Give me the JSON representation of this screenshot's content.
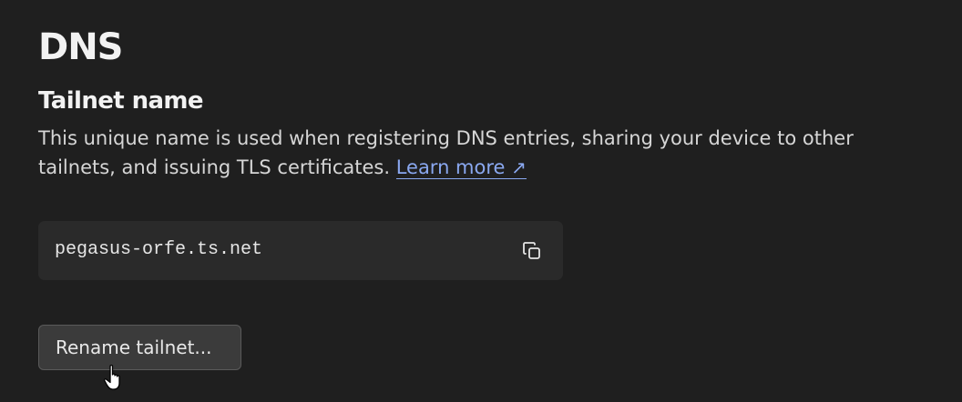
{
  "page": {
    "title": "DNS"
  },
  "tailnet_name": {
    "heading": "Tailnet name",
    "description": "This unique name is used when registering DNS entries, sharing your device to other tailnets, and issuing TLS certificates.",
    "learn_more_label": "Learn more",
    "learn_more_icon": "arrow-up-right-icon",
    "learn_more_arrow": "↗",
    "value": "pegasus-orfe.ts.net",
    "copy_icon": "copy-icon",
    "rename_button_label": "Rename tailnet..."
  },
  "colors": {
    "background": "#1f1f1f",
    "link": "#8aa8f0",
    "name_box": "#2a2a2a",
    "button": "#3b3b3b"
  }
}
